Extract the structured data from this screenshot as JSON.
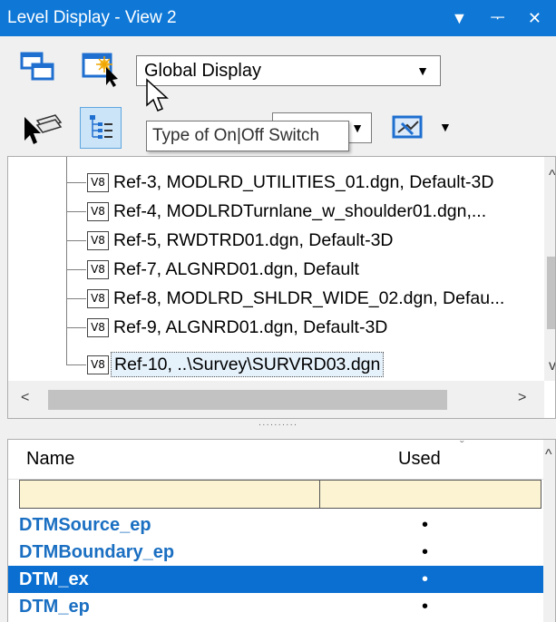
{
  "window": {
    "title": "Level Display - View 2",
    "dropdown_glyph": "▼",
    "pin_glyph": "ᅮ",
    "close_glyph": "✕"
  },
  "toolbar": {
    "display_mode": "Global Display",
    "display_mode_arrow": "▼",
    "tooltip": "Type of On|Off Switch",
    "small_combo_arrow": "▼",
    "extra_arrow": "▼"
  },
  "tree": {
    "badge": "V8",
    "items": [
      {
        "label": "Ref-3, MODLRD_UTILITIES_01.dgn, Default-3D"
      },
      {
        "label": "Ref-4, MODLRDTurnlane_w_shoulder01.dgn,..."
      },
      {
        "label": "Ref-5, RWDTRD01.dgn, Default-3D"
      },
      {
        "label": "Ref-7, ALGNRD01.dgn, Default"
      },
      {
        "label": "Ref-8, MODLRD_SHLDR_WIDE_02.dgn, Defau..."
      },
      {
        "label": "Ref-9, ALGNRD01.dgn, Default-3D"
      },
      {
        "label": "Ref-10, ..\\Survey\\SURVRD03.dgn"
      }
    ],
    "scroll_up": "^",
    "scroll_down": "v",
    "scroll_left": "<",
    "scroll_right": ">"
  },
  "splitter": {
    "grip": "··········"
  },
  "levels": {
    "columns": {
      "name": "Name",
      "used": "Used"
    },
    "sort_glyph": "ˇ",
    "scroll_up": "^",
    "rows": [
      {
        "name": "DTMSource_ep",
        "used": "•"
      },
      {
        "name": "DTMBoundary_ep",
        "used": "•"
      },
      {
        "name": "DTM_ex",
        "used": "•"
      },
      {
        "name": "DTM_ep",
        "used": "•"
      }
    ]
  },
  "colors": {
    "titlebar": "#0f78d7",
    "selection": "#0a6fd1",
    "level_name": "#1a6fc2",
    "filter_row": "#fbf3d2"
  }
}
